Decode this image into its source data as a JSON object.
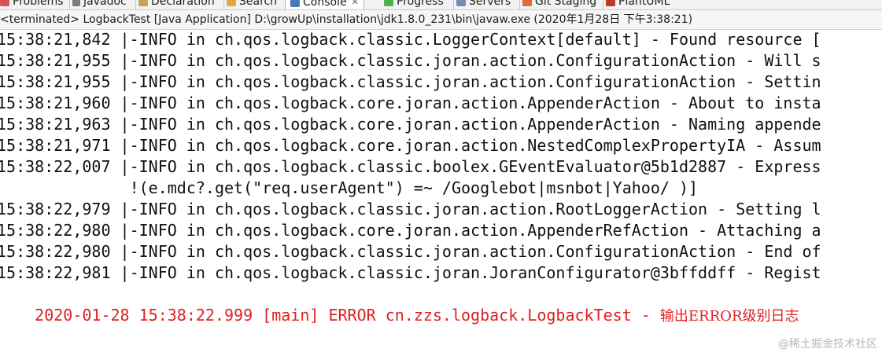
{
  "tabs": [
    {
      "label": "Problems",
      "icon": "problems-icon",
      "active": false
    },
    {
      "label": "Javadoc",
      "icon": "javadoc-icon",
      "active": false
    },
    {
      "label": "Declaration",
      "icon": "declaration-icon",
      "active": false
    },
    {
      "label": "Search",
      "icon": "search-icon",
      "active": false
    },
    {
      "label": "Console",
      "icon": "console-icon",
      "active": true,
      "close": "✕"
    },
    {
      "label": "Progress",
      "icon": "progress-icon",
      "active": false
    },
    {
      "label": "Servers",
      "icon": "servers-icon",
      "active": false
    },
    {
      "label": "Git Staging",
      "icon": "git-staging-icon",
      "active": false
    },
    {
      "label": "PlantUML",
      "icon": "plantuml-icon",
      "active": false
    }
  ],
  "status_line": "<terminated> LogbackTest [Java Application] D:\\growUp\\installation\\jdk1.8.0_231\\bin\\javaw.exe (2020年1月28日 下午3:38:21)",
  "console": {
    "lines": [
      {
        "text": "15:38:21,842 |-INFO in ch.qos.logback.classic.LoggerContext[default] - Found resource [",
        "type": "info"
      },
      {
        "text": "15:38:21,955 |-INFO in ch.qos.logback.classic.joran.action.ConfigurationAction - Will s",
        "type": "info"
      },
      {
        "text": "15:38:21,955 |-INFO in ch.qos.logback.classic.joran.action.ConfigurationAction - Settin",
        "type": "info"
      },
      {
        "text": "15:38:21,960 |-INFO in ch.qos.logback.core.joran.action.AppenderAction - About to insta",
        "type": "info"
      },
      {
        "text": "15:38:21,963 |-INFO in ch.qos.logback.core.joran.action.AppenderAction - Naming appende",
        "type": "info"
      },
      {
        "text": "15:38:21,971 |-INFO in ch.qos.logback.core.joran.action.NestedComplexPropertyIA - Assum",
        "type": "info"
      },
      {
        "text": "15:38:22,007 |-INFO in ch.qos.logback.classic.boolex.GEventEvaluator@5b1d2887 - Express",
        "type": "info"
      },
      {
        "text": "              !(e.mdc?.get(\"req.userAgent\") =~ /Googlebot|msnbot|Yahoo/ )]",
        "type": "info"
      },
      {
        "text": "15:38:22,979 |-INFO in ch.qos.logback.classic.joran.action.RootLoggerAction - Setting l",
        "type": "info"
      },
      {
        "text": "15:38:22,980 |-INFO in ch.qos.logback.core.joran.action.AppenderRefAction - Attaching a",
        "type": "info"
      },
      {
        "text": "15:38:22,980 |-INFO in ch.qos.logback.classic.joran.action.ConfigurationAction - End of",
        "type": "info"
      },
      {
        "text": "15:38:22,981 |-INFO in ch.qos.logback.classic.joran.JoranConfigurator@3bffddff - Regist",
        "type": "info"
      }
    ],
    "error_line": {
      "prefix": "2020-01-28 15:38:22.999 [main] ERROR cn.zzs.logback.LogbackTest - ",
      "message": "输出ERROR级别日志"
    }
  },
  "watermark": "@稀土掘金技术社区",
  "colors": {
    "error_text": "#e02020",
    "info_text": "#111111",
    "background": "#ffffff"
  }
}
